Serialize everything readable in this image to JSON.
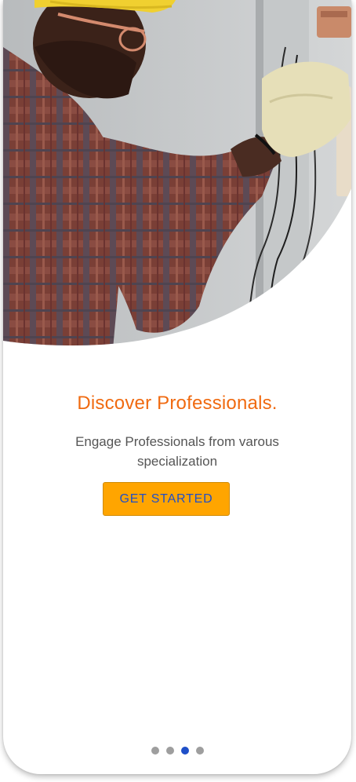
{
  "onboarding": {
    "hero_image": "electrician-worker-photo",
    "title": "Discover Professionals.",
    "subtitle": "Engage Professionals from varous specialization",
    "cta_label": "GET STARTED",
    "page_indicator": {
      "total": 4,
      "active_index": 2
    }
  },
  "colors": {
    "title": "#f06a10",
    "button_bg": "#ffa500",
    "button_text": "#1f4fc8",
    "dot_active": "#1f4fc8",
    "dot_inactive": "#9e9e9e"
  }
}
